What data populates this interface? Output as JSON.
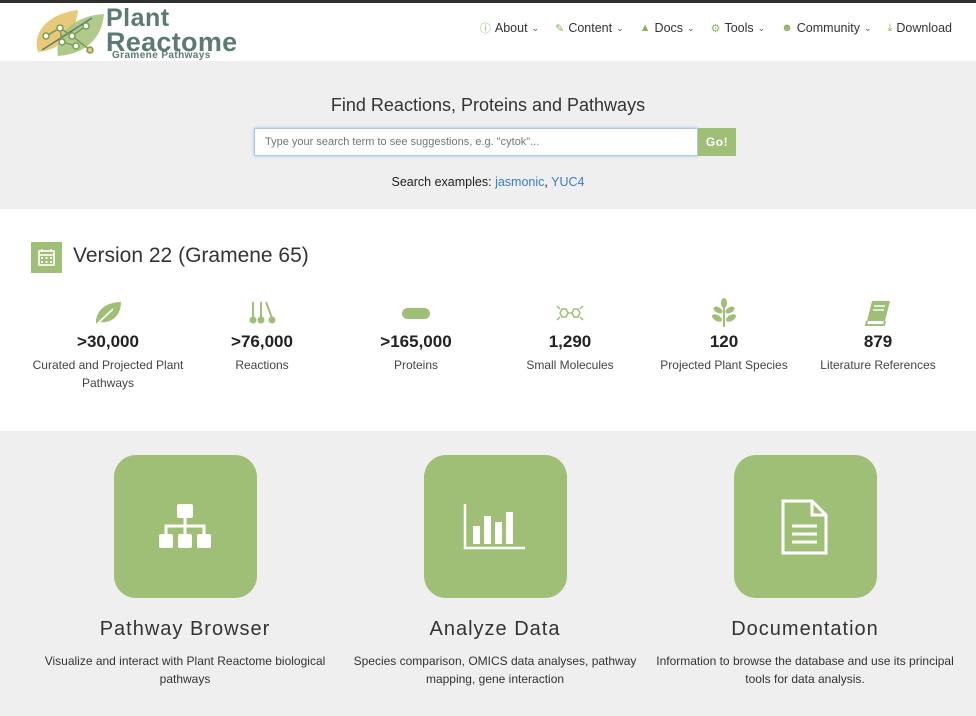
{
  "logo": {
    "line1": "Plant",
    "line2": "Reactome",
    "sub": "Gramene Pathways"
  },
  "nav": [
    {
      "label": "About",
      "icon": "info-icon"
    },
    {
      "label": "Content",
      "icon": "edit-icon"
    },
    {
      "label": "Docs",
      "icon": "graduation-cap-icon"
    },
    {
      "label": "Tools",
      "icon": "cogs-icon"
    },
    {
      "label": "Community",
      "icon": "users-icon"
    },
    {
      "label": "Download",
      "icon": "download-icon"
    }
  ],
  "search": {
    "title": "Find Reactions, Proteins and Pathways",
    "placeholder": "Type your search term to see suggestions, e.g. \"cytok\"...",
    "button": "Go!",
    "examples_label": "Search examples:",
    "example1": "jasmonic",
    "separator": ",",
    "example2": "YUC4"
  },
  "version": {
    "title": "Version 22 (Gramene 65)"
  },
  "stats": [
    {
      "value": ">30,000",
      "label": "Curated and Projected Plant Pathways",
      "icon": "leaf-icon"
    },
    {
      "value": ">76,000",
      "label": "Reactions",
      "icon": "reaction-icon"
    },
    {
      "value": ">165,000",
      "label": "Proteins",
      "icon": "protein-icon"
    },
    {
      "value": "1,290",
      "label": "Small Molecules",
      "icon": "molecule-icon"
    },
    {
      "value": "120",
      "label": "Projected Plant Species",
      "icon": "plant-icon"
    },
    {
      "value": "879",
      "label": "Literature References",
      "icon": "book-icon"
    }
  ],
  "tiles": [
    {
      "title": "Pathway Browser",
      "desc": "Visualize and interact with Plant Reactome biological pathways",
      "icon": "sitemap-icon"
    },
    {
      "title": "Analyze Data",
      "desc": "Species comparison, OMICS data analyses, pathway mapping, gene interaction",
      "icon": "bar-chart-icon"
    },
    {
      "title": "Documentation",
      "desc": "Information to browse the database and use its principal tools for data analysis.",
      "icon": "document-icon"
    }
  ],
  "colors": {
    "accent": "#9fbf76",
    "link": "#3a7cc9",
    "logo": "#5c7a74"
  }
}
